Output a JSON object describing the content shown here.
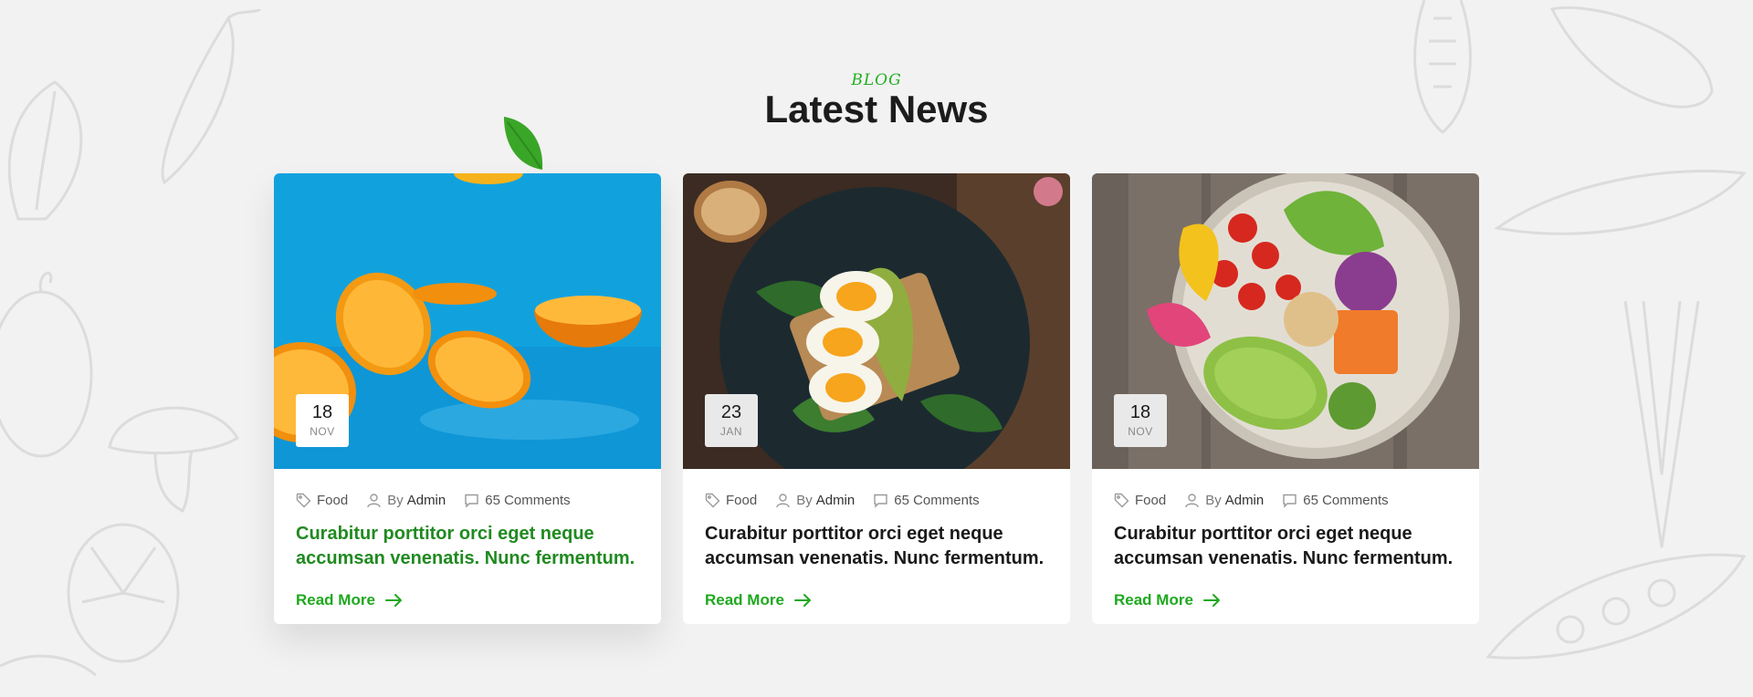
{
  "section": {
    "eyebrow": "BLOG",
    "title": "Latest News"
  },
  "posts": [
    {
      "image": "oranges-on-blue-photo",
      "day": "18",
      "month": "NOV",
      "category": "Food",
      "by_label": "By",
      "author": "Admin",
      "comments": "65 Comments",
      "title": "Curabitur porttitor orci eget neque accumsan venenatis. Nunc fermentum.",
      "read_more": "Read More"
    },
    {
      "image": "egg-avocado-toast-photo",
      "day": "23",
      "month": "JAN",
      "category": "Food",
      "by_label": "By",
      "author": "Admin",
      "comments": "65 Comments",
      "title": "Curabitur porttitor orci eget neque accumsan venenatis. Nunc fermentum.",
      "read_more": "Read More"
    },
    {
      "image": "salad-bowl-photo",
      "day": "18",
      "month": "NOV",
      "category": "Food",
      "by_label": "By",
      "author": "Admin",
      "comments": "65 Comments",
      "title": "Curabitur porttitor orci eget neque accumsan venenatis. Nunc fermentum.",
      "read_more": "Read More"
    }
  ],
  "icons": {
    "tag": "tag-icon",
    "user": "user-icon",
    "comment": "comment-icon",
    "arrow": "arrow-right-icon"
  },
  "colors": {
    "accent": "#1fa81f",
    "active_title": "#208a20",
    "background": "#f2f2f2"
  }
}
